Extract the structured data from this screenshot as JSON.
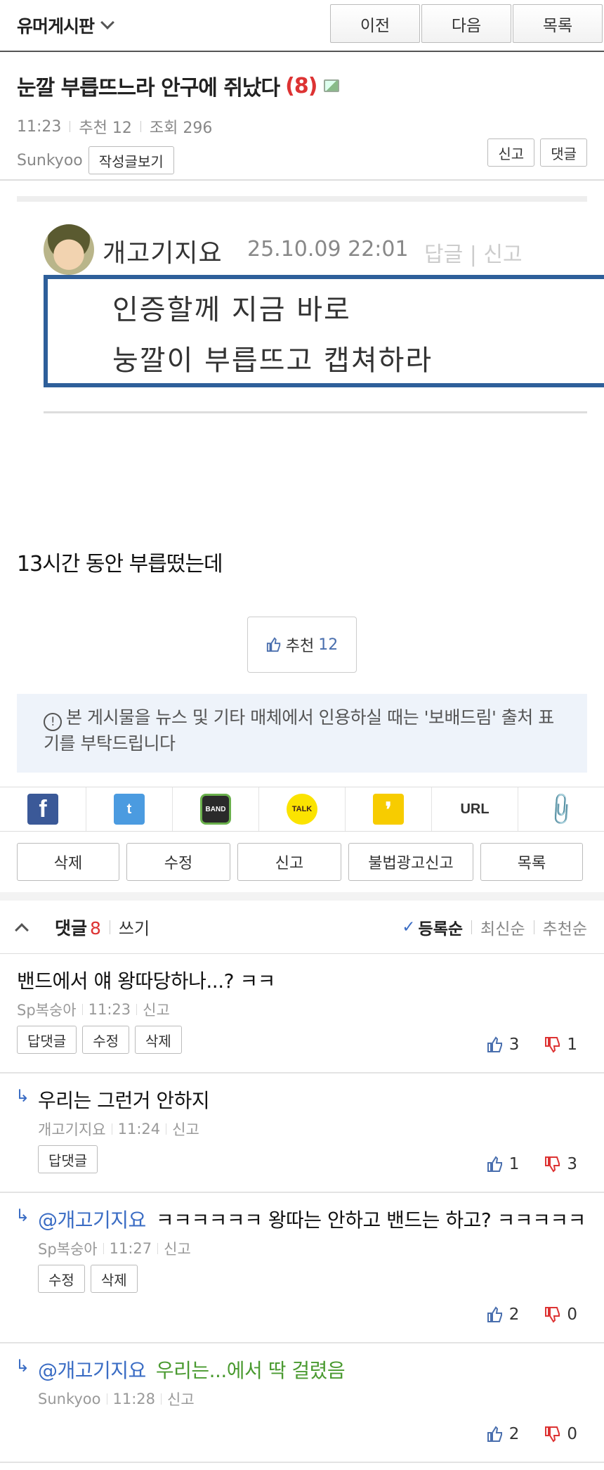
{
  "topbar": {
    "board_title": "유머게시판",
    "prev": "이전",
    "next": "다음",
    "list": "목록"
  },
  "post": {
    "title": "눈깔 부릅뜨느라 안구에 쥐났다",
    "comment_count": "(8)",
    "time": "11:23",
    "recommend": "추천 12",
    "views": "조회 296",
    "author": "Sunkyoo",
    "view_posts": "작성글보기",
    "report": "신고",
    "reply": "댓글"
  },
  "capture": {
    "username": "개고기지요",
    "date": "25.10.09 22:01",
    "actions": "답글 | 신고",
    "line1": "인증할께 지금 바로",
    "line2": "눙깔이 부릅뜨고 캡쳐하라"
  },
  "body_text": "13시간 동안 부릅떴는데",
  "recommend_button": {
    "label": "추천",
    "count": "12"
  },
  "notice": "본 게시물을 뉴스 및 기타 매체에서 인용하실 때는 '보배드림' 출처 표기를 부탁드립니다",
  "share": {
    "facebook": "f",
    "twitter": "t",
    "band": "BAND",
    "talk": "TALK",
    "story": "❜",
    "url": "URL",
    "clip": "📎"
  },
  "actions": [
    "삭제",
    "수정",
    "신고",
    "불법광고신고",
    "목록"
  ],
  "comments_header": {
    "label": "댓글",
    "count": "8",
    "write": "쓰기",
    "sort_registered": "등록순",
    "sort_latest": "최신순",
    "sort_recommended": "추천순"
  },
  "comments": [
    {
      "text": "밴드에서 얘 왕따당하나...? ㅋㅋ",
      "author": "Sp복숭아",
      "time": "11:23",
      "report": "신고",
      "buttons": [
        "답댓글",
        "수정",
        "삭제"
      ],
      "up": "3",
      "down": "1"
    },
    {
      "text": "우리는 그런거 안하지",
      "author": "개고기지요",
      "time": "11:24",
      "report": "신고",
      "buttons": [
        "답댓글"
      ],
      "up": "1",
      "down": "3"
    },
    {
      "mention": "@개고기지요",
      "text": "ㅋㅋㅋㅋㅋㅋ 왕따는 안하고 밴드는 하고? ㅋㅋㅋㅋㅋ",
      "author": "Sp복숭아",
      "time": "11:27",
      "report": "신고",
      "buttons": [
        "수정",
        "삭제"
      ],
      "up": "2",
      "down": "0"
    },
    {
      "mention": "@개고기지요",
      "text": "우리는...에서 딱 걸렸음",
      "author": "Sunkyoo",
      "time": "11:28",
      "report": "신고",
      "buttons": [],
      "up": "2",
      "down": "0"
    }
  ],
  "colors": {
    "accent_blue": "#2e5f9a",
    "count_red": "#d33333",
    "mention_blue": "#3a6cc4",
    "green_text": "#4a9a30",
    "notice_bg": "#eef3fa"
  }
}
